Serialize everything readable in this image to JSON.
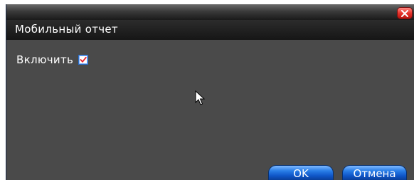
{
  "dialog": {
    "title": "Мобильный отчет",
    "close_icon": "close-icon"
  },
  "form": {
    "enable_label": "Включить",
    "enable_checked": true
  },
  "buttons": {
    "ok_label": "OK",
    "cancel_label": "Отмена"
  },
  "colors": {
    "panel_background": "#4a4a4a",
    "header_background": "#1a1a1a",
    "button_blue": "#1f6fe0",
    "close_red": "#e8332b",
    "check_red": "#e8202a"
  }
}
